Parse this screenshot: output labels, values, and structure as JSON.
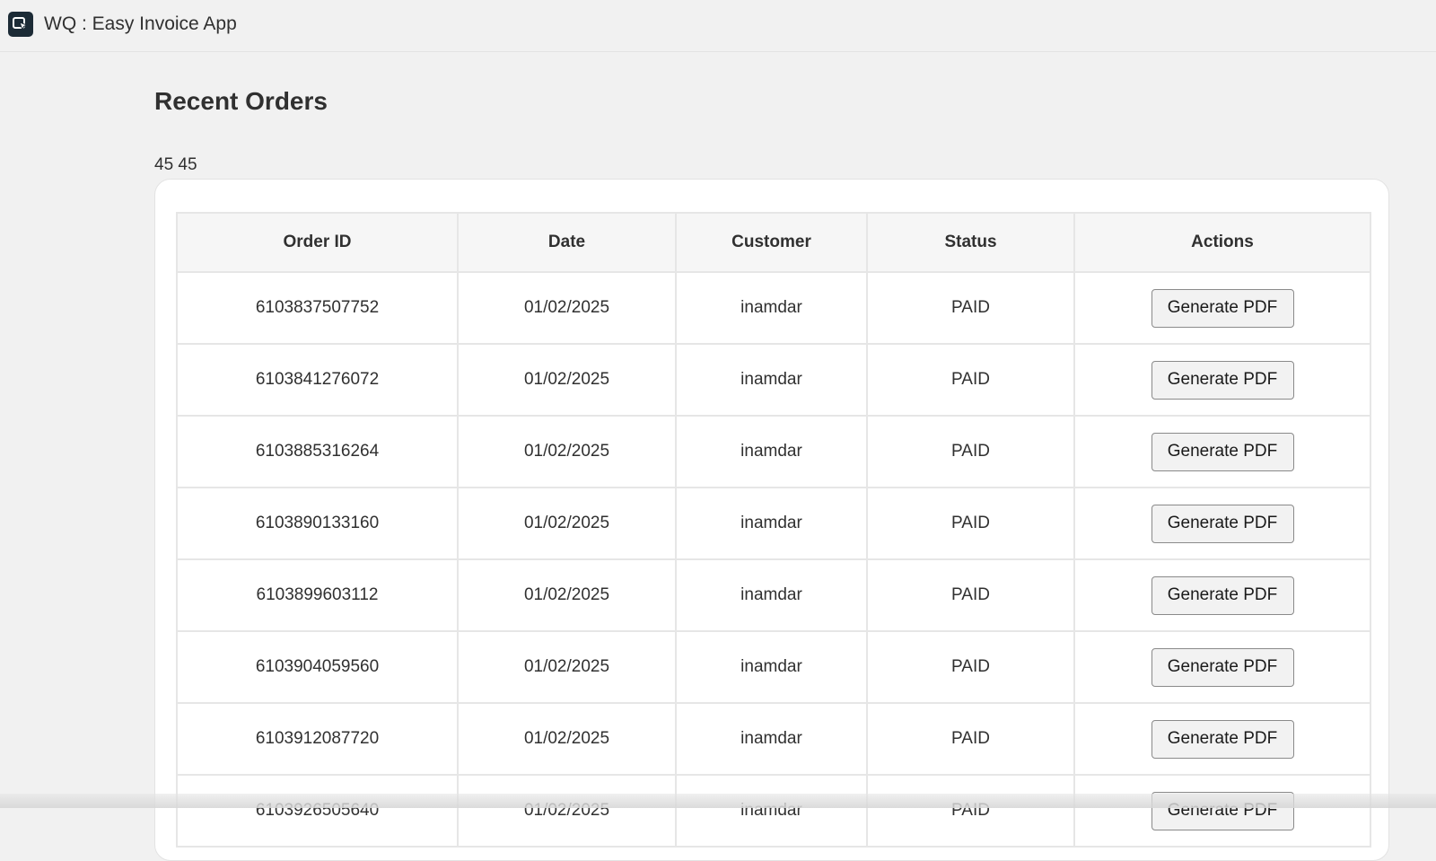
{
  "app": {
    "title": "WQ : Easy Invoice App",
    "icon": "app-cursor-icon"
  },
  "page": {
    "title": "Recent Orders",
    "counts": "45 45"
  },
  "table": {
    "headers": [
      "Order ID",
      "Date",
      "Customer",
      "Status",
      "Actions"
    ],
    "rows": [
      {
        "order_id": "6103837507752",
        "date": "01/02/2025",
        "customer": "inamdar",
        "status": "PAID",
        "action": "Generate PDF"
      },
      {
        "order_id": "6103841276072",
        "date": "01/02/2025",
        "customer": "inamdar",
        "status": "PAID",
        "action": "Generate PDF"
      },
      {
        "order_id": "6103885316264",
        "date": "01/02/2025",
        "customer": "inamdar",
        "status": "PAID",
        "action": "Generate PDF"
      },
      {
        "order_id": "6103890133160",
        "date": "01/02/2025",
        "customer": "inamdar",
        "status": "PAID",
        "action": "Generate PDF"
      },
      {
        "order_id": "6103899603112",
        "date": "01/02/2025",
        "customer": "inamdar",
        "status": "PAID",
        "action": "Generate PDF"
      },
      {
        "order_id": "6103904059560",
        "date": "01/02/2025",
        "customer": "inamdar",
        "status": "PAID",
        "action": "Generate PDF"
      },
      {
        "order_id": "6103912087720",
        "date": "01/02/2025",
        "customer": "inamdar",
        "status": "PAID",
        "action": "Generate PDF"
      },
      {
        "order_id": "6103926505640",
        "date": "01/02/2025",
        "customer": "inamdar",
        "status": "PAID",
        "action": "Generate PDF"
      }
    ]
  },
  "colors": {
    "background": "#f1f1f1",
    "card": "#ffffff",
    "header_bg": "#f6f6f6",
    "border": "#e6e6e6",
    "app_icon_bg": "#1c2b36"
  }
}
